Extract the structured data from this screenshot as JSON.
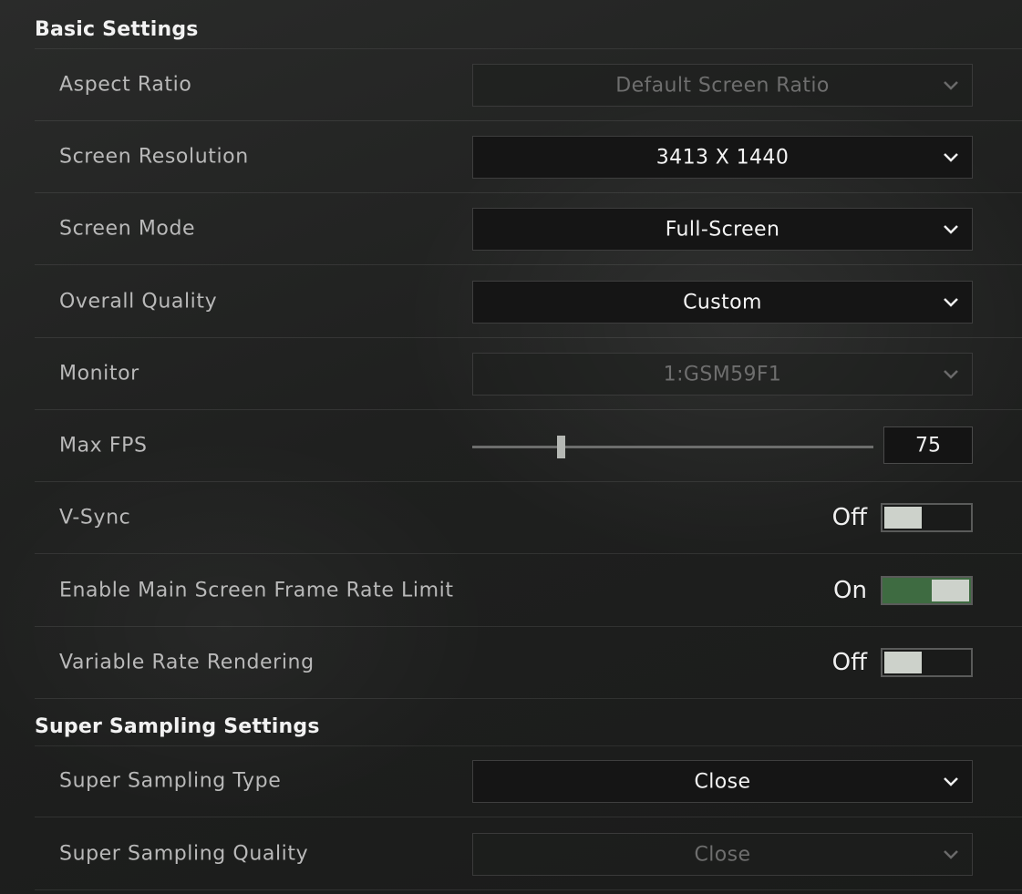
{
  "sections": {
    "basic": {
      "title": "Basic Settings",
      "aspect_ratio": {
        "label": "Aspect Ratio",
        "value": "Default Screen Ratio",
        "enabled": false
      },
      "screen_resolution": {
        "label": "Screen Resolution",
        "value": "3413 X 1440",
        "enabled": true
      },
      "screen_mode": {
        "label": "Screen Mode",
        "value": "Full-Screen",
        "enabled": true
      },
      "overall_quality": {
        "label": "Overall Quality",
        "value": "Custom",
        "enabled": true
      },
      "monitor": {
        "label": "Monitor",
        "value": "1:GSM59F1",
        "enabled": false
      },
      "max_fps": {
        "label": "Max FPS",
        "value": "75",
        "slider_fraction": 0.22
      },
      "vsync": {
        "label": "V-Sync",
        "state": "Off"
      },
      "frame_rate_limit": {
        "label": "Enable Main Screen Frame Rate Limit",
        "state": "On"
      },
      "variable_rate_rendering": {
        "label": "Variable Rate Rendering",
        "state": "Off"
      }
    },
    "super_sampling": {
      "title": "Super Sampling Settings",
      "type": {
        "label": "Super Sampling Type",
        "value": "Close",
        "enabled": true
      },
      "quality": {
        "label": "Super Sampling Quality",
        "value": "Close",
        "enabled": false
      }
    }
  },
  "icons": {
    "dropdown": "chevron-down-icon"
  },
  "colors": {
    "toggle_on": "#3e6b41",
    "toggle_knob": "#cdd2cb",
    "title_text": "#f2f2f2"
  }
}
